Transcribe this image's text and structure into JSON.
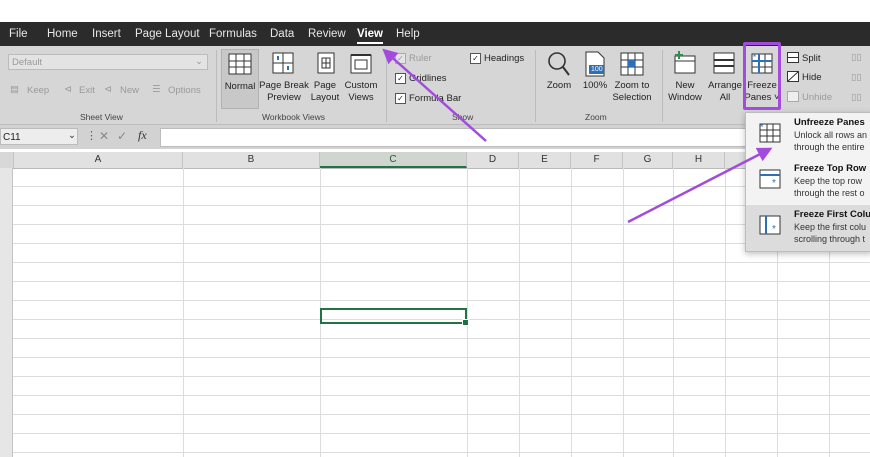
{
  "menu": [
    "File",
    "Home",
    "Insert",
    "Page Layout",
    "Formulas",
    "Data",
    "Review",
    "View",
    "Help"
  ],
  "menu_active": "View",
  "sheet_view": {
    "dropdown_value": "Default",
    "keep": "Keep",
    "exit": "Exit",
    "new": "New",
    "options": "Options",
    "group_label": "Sheet View"
  },
  "workbook_views": {
    "normal": "Normal",
    "page_break_1": "Page Break",
    "page_break_2": "Preview",
    "page_layout_1": "Page",
    "page_layout_2": "Layout",
    "custom_views_1": "Custom",
    "custom_views_2": "Views",
    "group_label": "Workbook Views"
  },
  "show": {
    "ruler": "Ruler",
    "gridlines": "Gridlines",
    "formula_bar": "Formula Bar",
    "headings": "Headings",
    "group_label": "Show"
  },
  "zoom": {
    "zoom": "Zoom",
    "hundred": "100%",
    "zoom_sel_1": "Zoom to",
    "zoom_sel_2": "Selection",
    "icon_text": "100",
    "group_label": "Zoom"
  },
  "window": {
    "new_1": "New",
    "new_2": "Window",
    "arrange_1": "Arrange",
    "arrange_2": "All",
    "freeze_1": "Freeze",
    "freeze_2": "Panes ˅",
    "split": "Split",
    "hide": "Hide",
    "unhide": "Unhide"
  },
  "formula_bar": {
    "name_box": "C11",
    "fx": "fx"
  },
  "columns": [
    "A",
    "B",
    "C",
    "D",
    "E",
    "F",
    "G",
    "H"
  ],
  "freeze_menu": [
    {
      "title": "Unfreeze Panes",
      "desc1": "Unlock all rows an",
      "desc2": "through the entire"
    },
    {
      "title": "Freeze Top Row",
      "desc1": "Keep the top row",
      "desc2": "through the rest o"
    },
    {
      "title": "Freeze First Colu",
      "desc1": "Keep the first colu",
      "desc2": "scrolling through t"
    }
  ],
  "colors": {
    "menubar": "#2b2b2b",
    "ribbon": "#d6d6d6",
    "accent_green": "#217346",
    "annotation_purple": "#a24bdc",
    "icon_blue": "#2f6fb5"
  }
}
